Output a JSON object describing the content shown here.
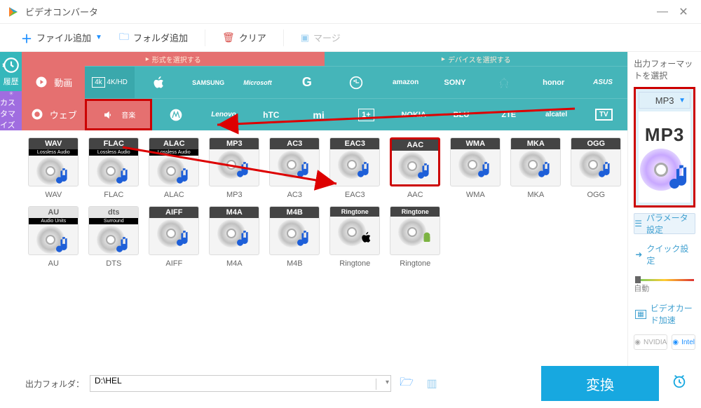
{
  "title": "ビデオコンバータ",
  "toolbar": {
    "add_file": "ファイル追加",
    "add_folder": "フォルダ追加",
    "clear": "クリア",
    "merge": "マージ"
  },
  "side": {
    "history": "履歴",
    "customize": "カスタマイズ"
  },
  "tabs": {
    "select_format": "形式を選択する",
    "select_device": "デバイスを選択する"
  },
  "categories": {
    "video": "動画",
    "fourk": "4K/HD",
    "web": "ウェブ",
    "music": "音楽"
  },
  "brand_row1": [
    "Apple",
    "SAMSUNG",
    "Microsoft",
    "G",
    "LG",
    "amazon",
    "SONY",
    "HUAWEI",
    "honor",
    "ASUS"
  ],
  "brand_row2": [
    "moto",
    "Lenovo",
    "hTC",
    "mi",
    "1+",
    "NOKIA",
    "BLU",
    "ZTE",
    "alcatel",
    "TV"
  ],
  "formats_row1": [
    {
      "code": "WAV",
      "label": "WAV",
      "hdr": "dark",
      "sub": "Lossless Audio"
    },
    {
      "code": "FLAC",
      "label": "FLAC",
      "hdr": "dark",
      "sub": "Lossless Audio"
    },
    {
      "code": "ALAC",
      "label": "ALAC",
      "hdr": "dark",
      "sub": "Lossless Audio"
    },
    {
      "code": "MP3",
      "label": "MP3",
      "hdr": "dark"
    },
    {
      "code": "AC3",
      "label": "AC3",
      "hdr": "dark"
    },
    {
      "code": "EAC3",
      "label": "EAC3",
      "hdr": "dark"
    },
    {
      "code": "AAC",
      "label": "AAC",
      "hdr": "dark",
      "selected": true
    },
    {
      "code": "WMA",
      "label": "WMA",
      "hdr": "dark"
    },
    {
      "code": "MKA",
      "label": "MKA",
      "hdr": "dark"
    },
    {
      "code": "OGG",
      "label": "OGG",
      "hdr": "dark"
    }
  ],
  "formats_row2": [
    {
      "code": "AU",
      "label": "AU",
      "hdr": "light",
      "sub": "Audio Units"
    },
    {
      "code": "dts",
      "label": "DTS",
      "hdr": "light",
      "sub": "Surround"
    },
    {
      "code": "AIFF",
      "label": "AIFF",
      "hdr": "dark"
    },
    {
      "code": "M4A",
      "label": "M4A",
      "hdr": "dark"
    },
    {
      "code": "M4B",
      "label": "M4B",
      "hdr": "dark"
    },
    {
      "code": "Ringtone",
      "label": "Ringtone",
      "hdr": "dark",
      "os": "apple"
    },
    {
      "code": "Ringtone",
      "label": "Ringtone",
      "hdr": "dark",
      "os": "android"
    }
  ],
  "right": {
    "caption": "出力フォーマットを選択",
    "selected": "MP3",
    "big_label": "MP3",
    "params": "パラメータ設定",
    "quick": "クイック設定",
    "auto": "自動",
    "gpu": "ビデオカード加速",
    "nvidia": "NVIDIA",
    "intel": "Intel"
  },
  "bottom": {
    "label": "出力フォルダ：",
    "path": "D:\\HEL",
    "convert": "変換"
  }
}
